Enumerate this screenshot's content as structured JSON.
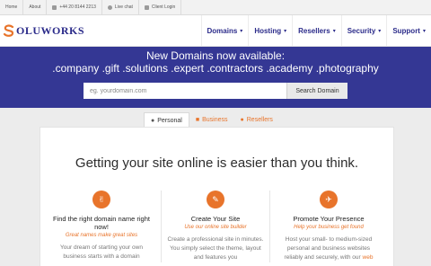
{
  "topbar": {
    "home": "Home",
    "about": "About",
    "phone": "+44 20 8144 2213",
    "live_chat": "Live chat",
    "client_login": "Client Login"
  },
  "header": {
    "logo_text": "OLUWORKS",
    "nav": [
      {
        "label": "Domains"
      },
      {
        "label": "Hosting"
      },
      {
        "label": "Resellers"
      },
      {
        "label": "Security"
      },
      {
        "label": "Support"
      }
    ]
  },
  "hero": {
    "line1": "New Domains now available:",
    "line2": ".company .gift .solutions .expert .contractors .academy .photography",
    "search_placeholder": "eg. yourdomain.com",
    "search_button": "Search Domain"
  },
  "tabs": [
    {
      "label": "Personal",
      "active": true
    },
    {
      "label": "Business",
      "active": false
    },
    {
      "label": "Resellers",
      "active": false
    }
  ],
  "main": {
    "heading": "Getting your site online is easier than you think.",
    "features": [
      {
        "title": "Find the right domain name right now!",
        "subtitle": "Great names make great sites",
        "description": "Your dream of starting your own business starts with a domain"
      },
      {
        "title": "Create Your Site",
        "subtitle": "Use our online site builder",
        "description": "Create a professional site in minutes. You simply select the theme, layout and features you"
      },
      {
        "title": "Promote Your Presence",
        "subtitle": "Help your business get found",
        "description": "Host your small- to medium-sized personal and business websites reliably and securely, with our",
        "link": "web"
      }
    ]
  },
  "colors": {
    "brand_blue": "#343794",
    "nav_text": "#2b2b8a",
    "accent_orange": "#e8742b"
  }
}
